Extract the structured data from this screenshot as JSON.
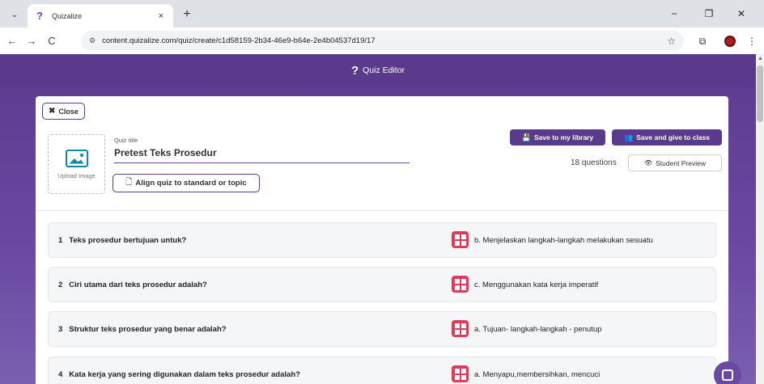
{
  "browser": {
    "tab_title": "Quizalize",
    "tab_close": "×",
    "new_tab": "+",
    "url": "content.quizalize.com/quiz/create/c1d58159-2b34-46e9-b64e-2e4b04537d19/17",
    "window_controls": {
      "minimize": "−",
      "restore": "❐",
      "close": "✕"
    },
    "nav": {
      "back": "←",
      "forward": "→",
      "reload": "C"
    },
    "star": "☆",
    "extensions": "⧉",
    "menu": "⋮"
  },
  "editor": {
    "header_title": "Quiz Editor",
    "logo_glyph": "❓"
  },
  "quiz": {
    "close_label": "Close",
    "upload_label": "Upload Image",
    "title_label": "Quiz title",
    "title_value": "Pretest Teks Prosedur",
    "align_label": "Align quiz to standard or topic",
    "save_library_label": "Save to my library",
    "save_class_label": "Save and give to class",
    "question_count": "18 questions",
    "preview_label": "Student Preview"
  },
  "questions": [
    {
      "num": "1",
      "text": "Teks prosedur bertujuan untuk?",
      "answer": "b. Menjelaskan langkah-langkah melakukan sesuatu"
    },
    {
      "num": "2",
      "text": "Ciri utama dari teks prosedur adalah?",
      "answer": "c. Menggunakan kata kerja imperatif"
    },
    {
      "num": "3",
      "text": "Struktur teks prosedur yang benar adalah?",
      "answer": "a. Tujuan- langkah-langkah - penutup"
    },
    {
      "num": "4",
      "text": "Kata kerja yang sering digunakan dalam teks prosedur adalah?",
      "answer": "a.    Menyapu,membersihkan, mencuci"
    }
  ],
  "colors": {
    "brand_purple": "#5a3a8c",
    "question_icon": "#e03a5a",
    "upload_icon": "#0f8ba3"
  }
}
